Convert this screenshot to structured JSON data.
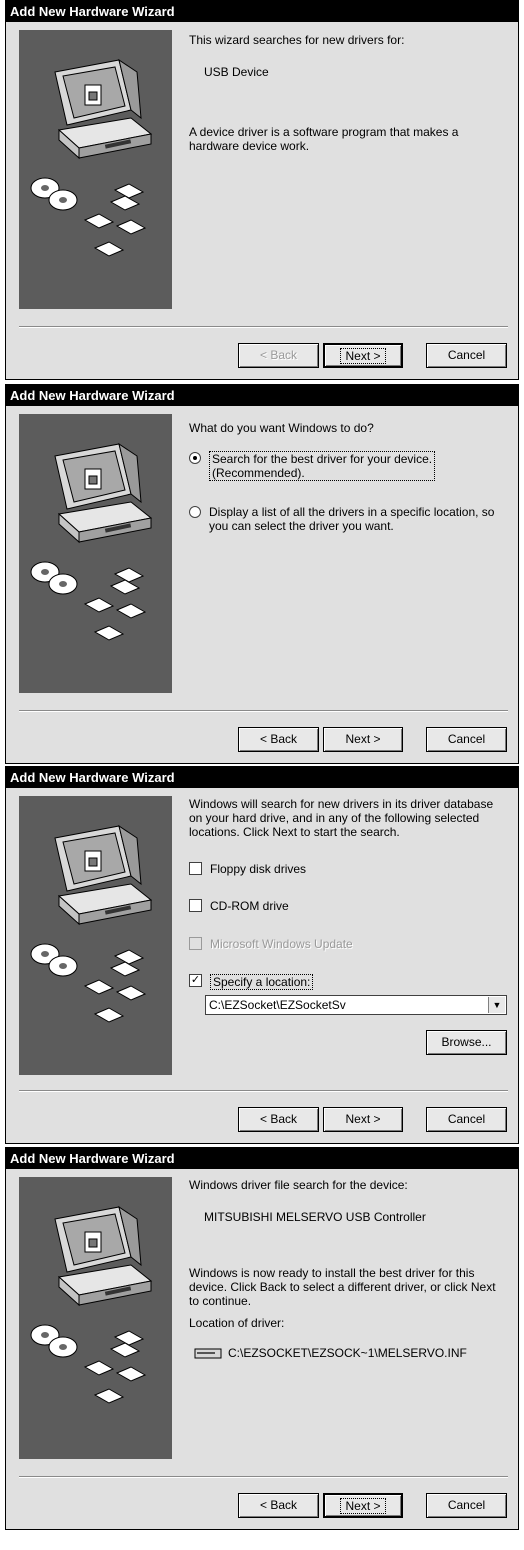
{
  "buttons": {
    "back": "< Back",
    "next": "Next >",
    "cancel": "Cancel",
    "browse": "Browse..."
  },
  "dialogs": [
    {
      "title": "Add New Hardware Wizard",
      "text1": "This wizard searches for new drivers for:",
      "device": "USB Device",
      "text2": "A device driver is a software program that makes a hardware device work."
    },
    {
      "title": "Add New Hardware Wizard",
      "question": "What do you want Windows to do?",
      "option1_line1": "Search for the best driver for your device.",
      "option1_line2": "(Recommended).",
      "option2": "Display a list of all the drivers in a specific location, so you can select the driver you want."
    },
    {
      "title": "Add New Hardware Wizard",
      "intro": "Windows will search for new drivers in its driver database on your hard drive, and in any of the following selected locations. Click Next to start the search.",
      "chk_floppy": "Floppy disk drives",
      "chk_cdrom": "CD-ROM drive",
      "chk_update": "Microsoft Windows Update",
      "chk_location": "Specify a location:",
      "location_value": "C:\\EZSocket\\EZSocketSv"
    },
    {
      "title": "Add New Hardware Wizard",
      "text1": "Windows driver file search for the device:",
      "device": "MITSUBISHI MELSERVO USB Controller",
      "text2": "Windows is now ready to install the best driver for this device. Click Back to select a different driver, or click Next to continue.",
      "location_label": "Location of driver:",
      "driver_path": "C:\\EZSOCKET\\EZSOCK~1\\MELSERVO.INF"
    }
  ]
}
